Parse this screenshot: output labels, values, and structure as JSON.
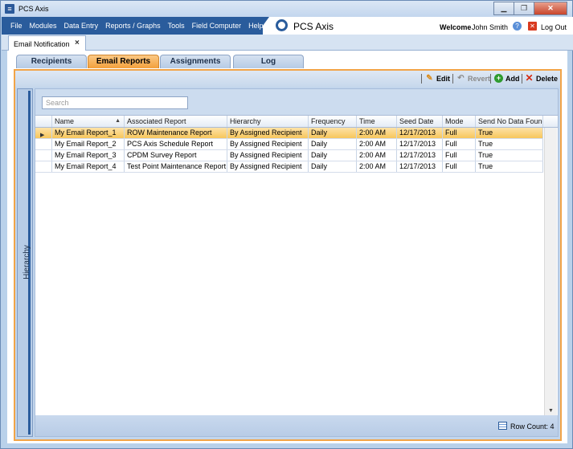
{
  "window": {
    "title": "PCS Axis",
    "app_icon": "pcs-axis-app-icon",
    "controls": [
      "minimize-icon",
      "maximize-icon",
      "close-icon"
    ]
  },
  "menu": {
    "items": [
      "File",
      "Modules",
      "Data Entry",
      "Reports / Graphs",
      "Tools",
      "Field Computer",
      "Help"
    ]
  },
  "brand": {
    "name": "PCS Axis"
  },
  "user": {
    "welcome_label": "Welcome",
    "name": "John Smith",
    "logout_label": "Log Out"
  },
  "doc_tab": {
    "label": "Email Notification"
  },
  "tabs": [
    {
      "label": "Recipients",
      "active": false
    },
    {
      "label": "Email Reports",
      "active": true
    },
    {
      "label": "Assignments",
      "active": false
    },
    {
      "label": "Log",
      "active": false
    }
  ],
  "toolbar": {
    "edit": "Edit",
    "revert": "Revert",
    "add": "Add",
    "delete": "Delete"
  },
  "side_panel": {
    "label": "Hierarchy"
  },
  "search": {
    "placeholder": "Search"
  },
  "grid": {
    "columns": [
      "Name",
      "Associated Report",
      "Hierarchy",
      "Frequency",
      "Time",
      "Seed Date",
      "Mode",
      "Send No Data Found"
    ],
    "rows": [
      [
        "My Email Report_1",
        "ROW Maintenance Report",
        "By Assigned Recipient",
        "Daily",
        "2:00 AM",
        "12/17/2013",
        "Full",
        "True"
      ],
      [
        "My Email Report_2",
        "PCS Axis Schedule Report",
        "By Assigned Recipient",
        "Daily",
        "2:00 AM",
        "12/17/2013",
        "Full",
        "True"
      ],
      [
        "My Email Report_3",
        "CPDM Survey Report",
        "By Assigned Recipient",
        "Daily",
        "2:00 AM",
        "12/17/2013",
        "Full",
        "True"
      ],
      [
        "My Email Report_4",
        "Test Point Maintenance Report",
        "By Assigned Recipient",
        "Daily",
        "2:00 AM",
        "12/17/2013",
        "Full",
        "True"
      ]
    ],
    "selected_row": 0
  },
  "status": {
    "row_count_label": "Row Count:",
    "row_count": "4"
  },
  "colors": {
    "menu_bg": "#2a5c9c",
    "active_tab": "#f3a03c",
    "panel_border": "#f2a447",
    "selected_row": "#f7c65b"
  }
}
